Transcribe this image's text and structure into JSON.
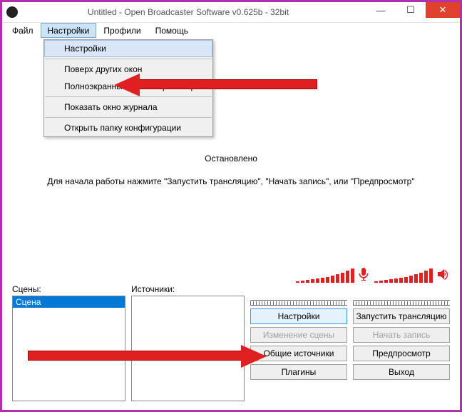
{
  "window": {
    "title": "Untitled - Open Broadcaster Software v0.625b - 32bit"
  },
  "menubar": {
    "items": [
      {
        "label": "Файл"
      },
      {
        "label": "Настройки"
      },
      {
        "label": "Профили"
      },
      {
        "label": "Помощь"
      }
    ]
  },
  "dropdown": {
    "items": [
      {
        "label": "Настройки"
      },
      {
        "label": "Поверх других окон"
      },
      {
        "label": "Полноэкранный режим просмотра"
      },
      {
        "label": "Показать окно журнала"
      },
      {
        "label": "Открыть папку конфигурации"
      }
    ]
  },
  "status": {
    "main": "Остановлено",
    "hint": "Для начала работы нажмите \"Запустить трансляцию\", \"Начать запись\", или \"Предпросмотр\""
  },
  "panels": {
    "scenes_label": "Сцены:",
    "sources_label": "Источники:",
    "scenes": [
      {
        "label": "Сцена"
      }
    ],
    "sources": []
  },
  "buttons": {
    "col1": [
      {
        "label": "Настройки",
        "enabled": true,
        "highlight": true
      },
      {
        "label": "Изменение сцены",
        "enabled": false
      },
      {
        "label": "Общие источники",
        "enabled": true
      },
      {
        "label": "Плагины",
        "enabled": true
      }
    ],
    "col2": [
      {
        "label": "Запустить трансляцию",
        "enabled": true
      },
      {
        "label": "Начать запись",
        "enabled": false
      },
      {
        "label": "Предпросмотр",
        "enabled": true
      },
      {
        "label": "Выход",
        "enabled": true
      }
    ]
  },
  "meters": {
    "mic": {
      "levels": [
        2,
        3,
        4,
        5,
        6,
        7,
        8,
        10,
        12,
        14,
        17,
        20
      ]
    },
    "speaker": {
      "levels": [
        2,
        3,
        4,
        5,
        6,
        7,
        8,
        10,
        12,
        14,
        17,
        20
      ]
    }
  },
  "colors": {
    "accent": "#0078d7",
    "annotation": "#e02020",
    "frame": "#b030b0"
  }
}
